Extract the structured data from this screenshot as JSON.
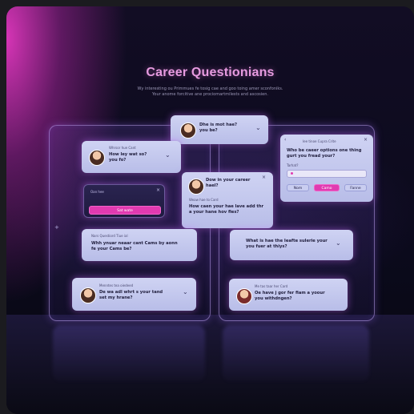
{
  "header": {
    "title": "Career Questionians",
    "subtitle_line1": "Wy interesting ou Primmues fe tosig cae and goo toing amer sconfoniks.",
    "subtitle_line2": "Your anome forcitive ane prociomartmilests and ascosien."
  },
  "cards": {
    "top_center": {
      "question": "Dhe is mot hae?\nyou be?"
    },
    "left_1": {
      "small": "Whrsor hue Cant",
      "question": "How ley wat so?\nyou fo?"
    },
    "left_input": {
      "label": "Oan hee",
      "button": "Sat wate"
    },
    "center_float": {
      "question_top": "Dow in your career\nhael?",
      "small": "Weaw hae to Card",
      "question": "How caen your hae lave add thr\na your hane hov fies?"
    },
    "right_form": {
      "small": "Iee tinoe Cupra Crite",
      "question": "Who be caeer options one thing\ngurt you fread your?",
      "field_label": "Tarhat?",
      "btn_1": "Nom",
      "btn_2": "Camo",
      "btn_3": "Fanne"
    },
    "left_2": {
      "small": "Nars Questiord Tiue ial",
      "question": "Whh ynuar neaar cant Cams by aonn\nfe your Cams be?"
    },
    "right_2": {
      "question": "What is hae the Ieafte sulerie your\nyou fuer at thiys?"
    },
    "left_3": {
      "small": "Menntes tea oiedeed",
      "question": "De wa adl whrt s your tand\nset my hrane?"
    },
    "right_3": {
      "small": "Me tas taar her Card",
      "question": "Oe have j gor fer fiam a yoour\nyou withdngen?"
    }
  },
  "icons": {
    "chevron": "⌄",
    "close": "×",
    "plus": "+"
  },
  "colors": {
    "accent": "#e13ab0",
    "title": "#e79be0"
  }
}
